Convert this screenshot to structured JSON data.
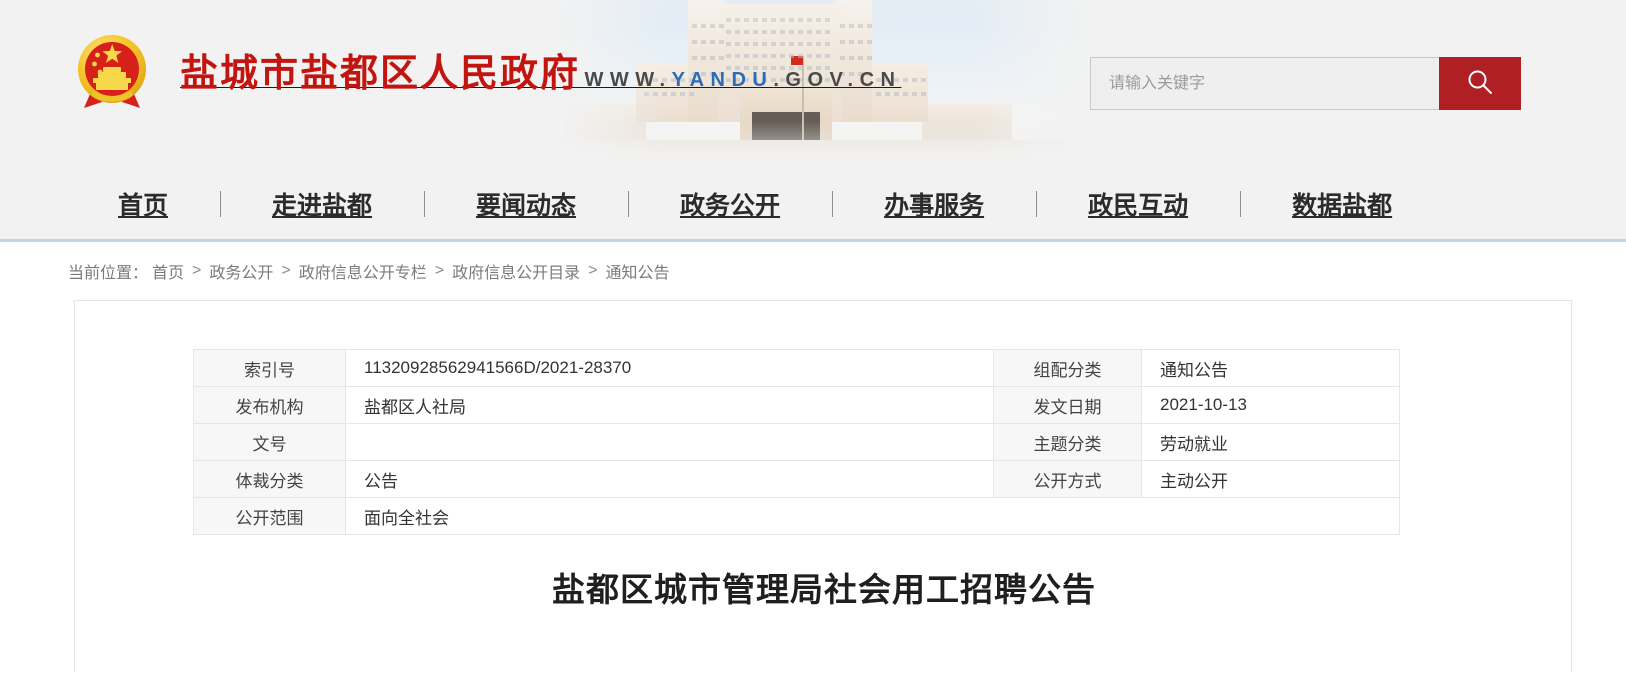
{
  "site": {
    "title": "盐城市盐都区人民政府",
    "url_prefix": "WWW.",
    "url_highlight": "YANDU",
    "url_suffix": ".GOV.CN",
    "url_full": "WWW.YANDU.GOV.CN",
    "emblem_icon": "national-emblem-icon",
    "brand_color": "#c3150f",
    "accent_color": "#b01f24"
  },
  "search": {
    "placeholder": "请输入关键字",
    "value": "",
    "button_icon": "search-icon"
  },
  "nav": {
    "items": [
      {
        "label": "首页"
      },
      {
        "label": "走进盐都"
      },
      {
        "label": "要闻动态"
      },
      {
        "label": "政务公开"
      },
      {
        "label": "办事服务"
      },
      {
        "label": "政民互动"
      },
      {
        "label": "数据盐都"
      }
    ]
  },
  "breadcrumb": {
    "label": "当前位置：",
    "separator": ">",
    "items": [
      {
        "label": "首页"
      },
      {
        "label": "政务公开"
      },
      {
        "label": "政府信息公开专栏"
      },
      {
        "label": "政府信息公开目录"
      },
      {
        "label": "通知公告"
      }
    ]
  },
  "info_table": {
    "rows": [
      {
        "k1": "索引号",
        "v1": "11320928562941566D/2021-28370",
        "k2": "组配分类",
        "v2": "通知公告"
      },
      {
        "k1": "发布机构",
        "v1": "盐都区人社局",
        "k2": "发文日期",
        "v2": "2021-10-13"
      },
      {
        "k1": "文号",
        "v1": "",
        "k2": "主题分类",
        "v2": "劳动就业"
      },
      {
        "k1": "体裁分类",
        "v1": "公告",
        "k2": "公开方式",
        "v2": "主动公开"
      }
    ],
    "last_row": {
      "k1": "公开范围",
      "v1": "面向全社会"
    }
  },
  "document": {
    "title": "盐都区城市管理局社会用工招聘公告"
  }
}
